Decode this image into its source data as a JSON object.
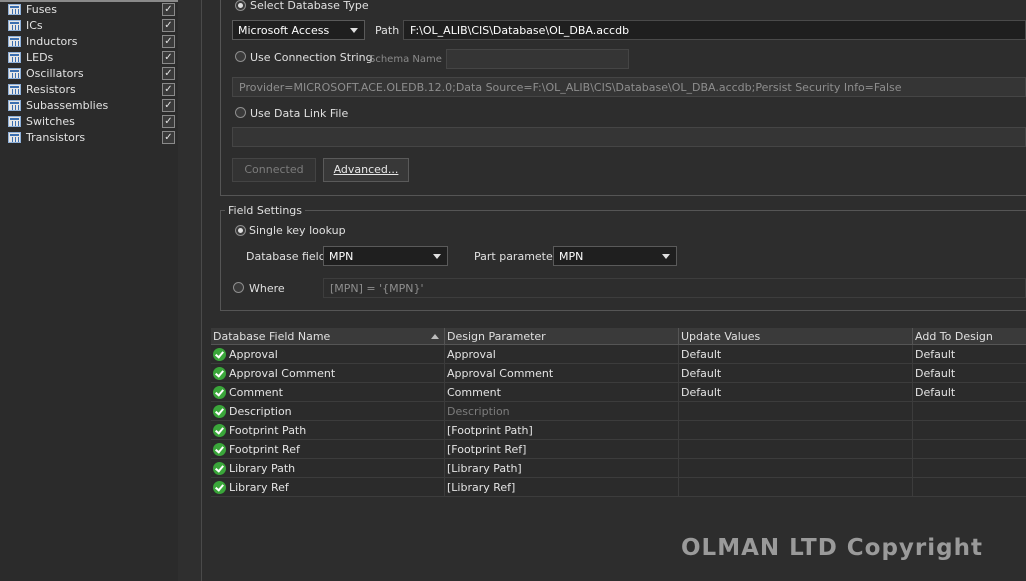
{
  "tree": {
    "items": [
      {
        "label": "Fuses",
        "checked": true
      },
      {
        "label": "ICs",
        "checked": true
      },
      {
        "label": "Inductors",
        "checked": true
      },
      {
        "label": "LEDs",
        "checked": true
      },
      {
        "label": "Oscillators",
        "checked": true
      },
      {
        "label": "Resistors",
        "checked": true
      },
      {
        "label": "Subassemblies",
        "checked": true
      },
      {
        "label": "Switches",
        "checked": true
      },
      {
        "label": "Transistors",
        "checked": true
      }
    ],
    "check_glyph": "✓"
  },
  "connection": {
    "select_db_type_label": "Select Database Type",
    "db_type_value": "Microsoft Access",
    "path_label": "Path",
    "path_value": "F:\\OL_ALIB\\CIS\\Database\\OL_DBA.accdb",
    "use_conn_string_label": "Use Connection String",
    "schema_name_label": "Schema Name",
    "schema_name_value": "",
    "connection_string_value": "Provider=MICROSOFT.ACE.OLEDB.12.0;Data Source=F:\\OL_ALIB\\CIS\\Database\\OL_DBA.accdb;Persist Security Info=False",
    "use_data_link_label": "Use Data Link File",
    "data_link_value": "",
    "connected_button": "Connected",
    "advanced_button": "Advanced..."
  },
  "field_settings": {
    "title": "Field Settings",
    "single_key_label": "Single key lookup",
    "database_field_label": "Database field",
    "database_field_value": "MPN",
    "part_parameter_label": "Part parameter",
    "part_parameter_value": "MPN",
    "where_label": "Where",
    "where_value": "[MPN] = '{MPN}'"
  },
  "grid": {
    "columns": [
      "Database Field Name",
      "Design Parameter",
      "Update Values",
      "Add To Design"
    ],
    "rows": [
      {
        "field": "Approval",
        "param": "Approval",
        "update": "Default",
        "add": "Default",
        "param_dim": false
      },
      {
        "field": "Approval Comment",
        "param": "Approval Comment",
        "update": "Default",
        "add": "Default",
        "param_dim": false
      },
      {
        "field": "Comment",
        "param": "Comment",
        "update": "Default",
        "add": "Default",
        "param_dim": false
      },
      {
        "field": "Description",
        "param": "Description",
        "update": "",
        "add": "",
        "param_dim": true
      },
      {
        "field": "Footprint Path",
        "param": "[Footprint Path]",
        "update": "",
        "add": "",
        "param_dim": false
      },
      {
        "field": "Footprint Ref",
        "param": "[Footprint Ref]",
        "update": "",
        "add": "",
        "param_dim": false
      },
      {
        "field": "Library Path",
        "param": "[Library Path]",
        "update": "",
        "add": "",
        "param_dim": false
      },
      {
        "field": "Library Ref",
        "param": "[Library Ref]",
        "update": "",
        "add": "",
        "param_dim": false
      }
    ]
  },
  "watermark": "OLMAN LTD Copyright"
}
